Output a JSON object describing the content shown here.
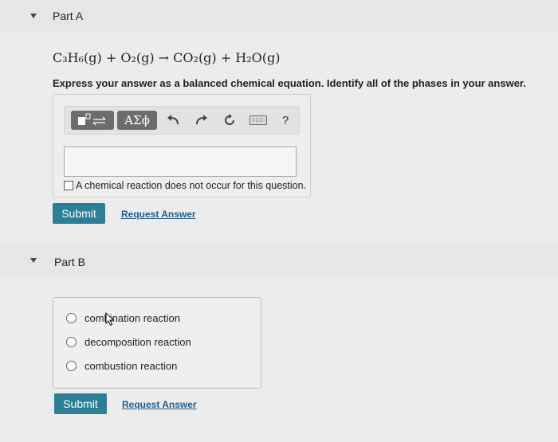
{
  "partA": {
    "title": "Part A",
    "equation": "C₃H₆(g) + O₂(g) → CO₂(g) + H₂O(g)",
    "instruction": "Express your answer as a balanced chemical equation. Identify all of the phases in your answer.",
    "toolbar": {
      "greek_label": "ΑΣϕ",
      "help_label": "?"
    },
    "answer_value": "",
    "no_reaction_label": "A chemical reaction does not occur for this question.",
    "submit_label": "Submit",
    "request_label": "Request Answer"
  },
  "partB": {
    "title": "Part B",
    "options": [
      {
        "label": "combination reaction"
      },
      {
        "label": "decomposition reaction"
      },
      {
        "label": "combustion reaction"
      }
    ],
    "submit_label": "Submit",
    "request_label": "Request Answer"
  }
}
